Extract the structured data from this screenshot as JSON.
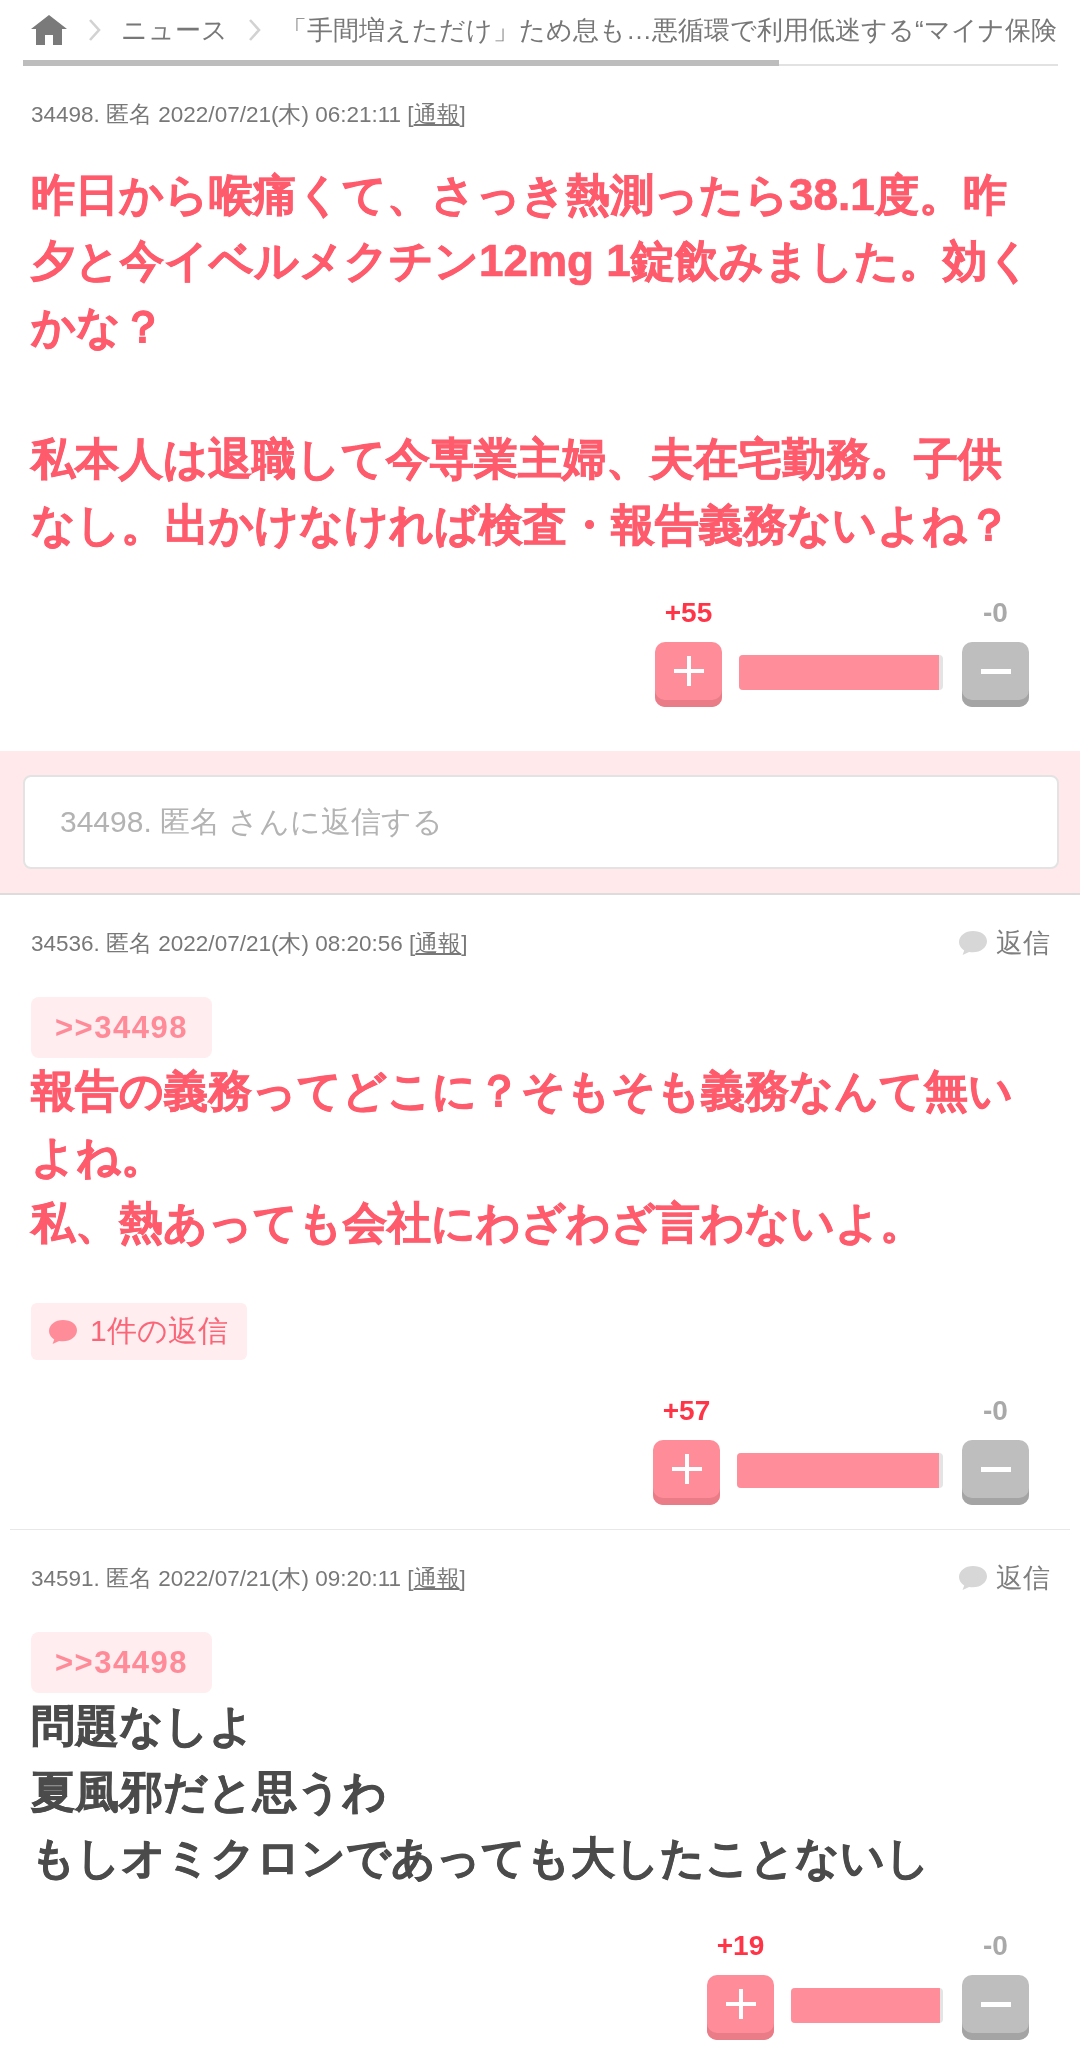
{
  "breadcrumb": {
    "section": "ニュース",
    "title": "「手間増えただけ」ため息も…悪循環で利用低迷する“マイナ保険"
  },
  "reading_progress": {
    "level": 0.73
  },
  "comments": [
    {
      "meta": "34498. 匿名 2022/07/21(木) 06:21:11",
      "report": {
        "prefix": "[",
        "label": "通報",
        "suffix": "]"
      },
      "paragraphs": [
        [
          "昨日から喉痛くて、さっき熱測ったら38.1度。昨夕と今イベルメクチン12mg 1錠飲みました。効くかな？"
        ],
        [
          "私本人は退職して今専業主婦、夫在宅勤務。子供なし。出かけなければ検査・報告義務ないよね？"
        ]
      ],
      "highlighted": true,
      "votes": {
        "plus": "+55",
        "minus": "-0",
        "level": 0.98
      },
      "reply_field": {
        "placeholder": "34498. 匿名 さんに返信する"
      }
    },
    {
      "meta": "34536. 匿名 2022/07/21(木) 08:20:56",
      "report": {
        "prefix": "[",
        "label": "通報",
        "suffix": "]"
      },
      "reply_button": "返信",
      "anchor": ">>34498",
      "paragraphs": [
        [
          "報告の義務ってどこに？そもそも義務なんて無いよね。",
          "私、熱あっても会社にわざわざ言わないよ。"
        ]
      ],
      "highlighted": true,
      "replies": "1件の返信",
      "votes": {
        "plus": "+57",
        "minus": "-0",
        "level": 0.98
      }
    },
    {
      "meta": "34591. 匿名 2022/07/21(木) 09:20:11",
      "report": {
        "prefix": "[",
        "label": "通報",
        "suffix": "]"
      },
      "reply_button": "返信",
      "anchor": ">>34498",
      "paragraphs": [
        [
          "問題なしよ",
          "夏風邪だと思うわ",
          "もしオミクロンであっても大したことないし"
        ]
      ],
      "highlighted": false,
      "votes": {
        "plus": "+19",
        "minus": "-0",
        "level": 0.98
      }
    }
  ]
}
